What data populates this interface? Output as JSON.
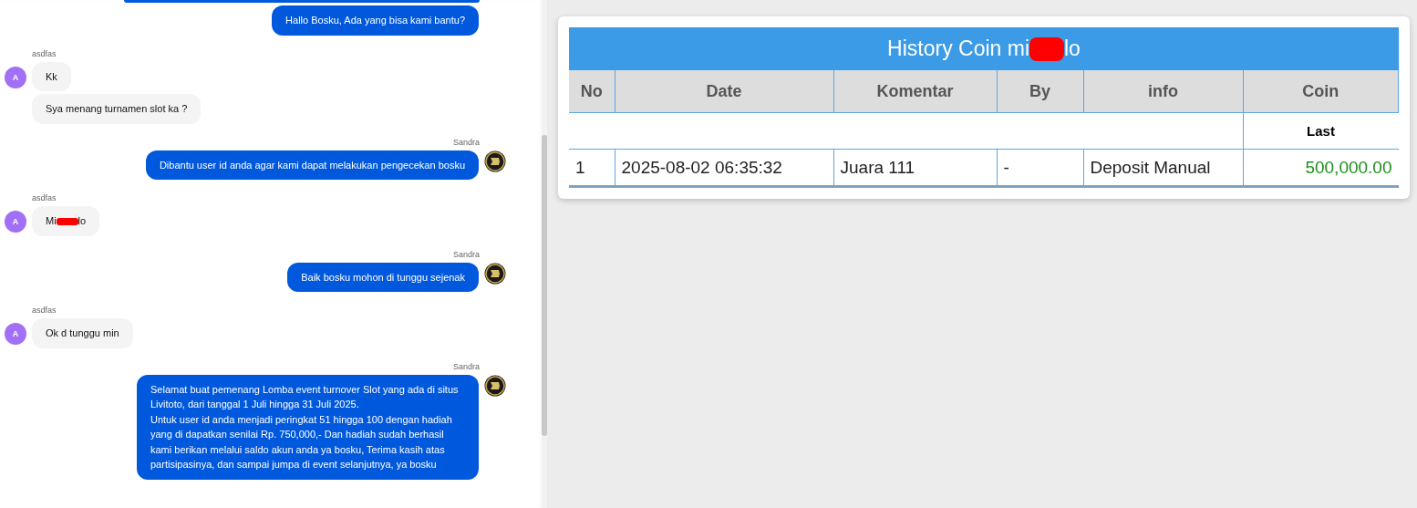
{
  "chat": {
    "messages": [
      {
        "kind": "cut"
      },
      {
        "kind": "agent",
        "avatar": false,
        "parts": [
          {
            "kind": "text",
            "text": "Hallo Bosku, Ada yang bisa kami bantu?"
          }
        ]
      },
      {
        "kind": "user",
        "sender": "asdfas",
        "avatar_letter": "A",
        "parts": [
          {
            "kind": "text",
            "text": "Kk"
          }
        ]
      },
      {
        "kind": "user",
        "parts": [
          {
            "kind": "text",
            "text": "Sya menang turnamen slot ka ?"
          }
        ]
      },
      {
        "kind": "agent",
        "sender": "Sandra",
        "avatar": true,
        "parts": [
          {
            "kind": "text",
            "text": "Dibantu user id anda agar kami dapat melakukan pengecekan bosku"
          }
        ]
      },
      {
        "kind": "user",
        "sender": "asdfas",
        "avatar_letter": "A",
        "parts": [
          {
            "kind": "text",
            "text": "Mi"
          },
          {
            "kind": "redaction"
          },
          {
            "kind": "text",
            "text": "lo"
          }
        ]
      },
      {
        "kind": "agent",
        "sender": "Sandra",
        "avatar": true,
        "parts": [
          {
            "kind": "text",
            "text": "Baik bosku mohon di tunggu sejenak"
          }
        ]
      },
      {
        "kind": "user",
        "sender": "asdfas",
        "avatar_letter": "A",
        "parts": [
          {
            "kind": "text",
            "text": "Ok d tunggu min"
          }
        ]
      },
      {
        "kind": "agent",
        "sender": "Sandra",
        "avatar": true,
        "parts": [
          {
            "kind": "text",
            "text": "Selamat buat pemenang Lomba event turnover Slot yang ada di situs Livitoto, dari tanggal 1 Juli hingga 31 Juli 2025.\nUntuk user id anda menjadi peringkat 51 hingga 100 dengan hadiah yang di dapatkan senilai Rp. 750,000,- Dan hadiah sudah berhasil kami berikan melalui saldo akun anda ya bosku, Terima kasih atas partisipasinya, dan sampai jumpa di event selanjutnya, ya bosku"
          }
        ]
      }
    ]
  },
  "history": {
    "title": [
      {
        "kind": "text",
        "text": "History Coin mi"
      },
      {
        "kind": "redaction"
      },
      {
        "kind": "text",
        "text": "lo"
      }
    ],
    "columns": [
      "No",
      "Date",
      "Komentar",
      "By",
      "info",
      "Coin"
    ],
    "subheader": "Last",
    "rows": [
      {
        "no": "1",
        "date": "2025-08-02 06:35:32",
        "komentar": "Juara 111",
        "by": "-",
        "info": "Deposit Manual",
        "coin": "500,000.00"
      }
    ]
  }
}
